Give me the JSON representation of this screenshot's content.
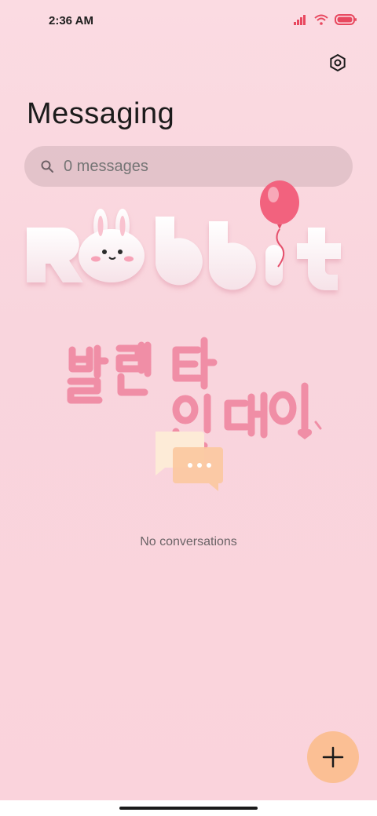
{
  "status_bar": {
    "time": "2:36 AM",
    "icons": [
      "signal-icon",
      "wifi-icon",
      "battery-icon"
    ]
  },
  "header": {
    "title": "Messaging",
    "settings_icon": "settings-icon"
  },
  "search": {
    "placeholder": "0 messages",
    "icon": "search-icon"
  },
  "decoration": {
    "theme_word": "Rabbit",
    "korean_text": "발렌타인데이",
    "icons": [
      "bunny-icon",
      "balloon-icon",
      "heart-icon"
    ]
  },
  "empty_state": {
    "icon": "chat-bubbles-icon",
    "text": "No conversations"
  },
  "fab": {
    "icon": "plus-icon"
  },
  "colors": {
    "accent_fab": "#fbbf94",
    "theme_pink": "#f08ea6",
    "background": "#fbdbe2",
    "status_red": "#e8485f"
  }
}
